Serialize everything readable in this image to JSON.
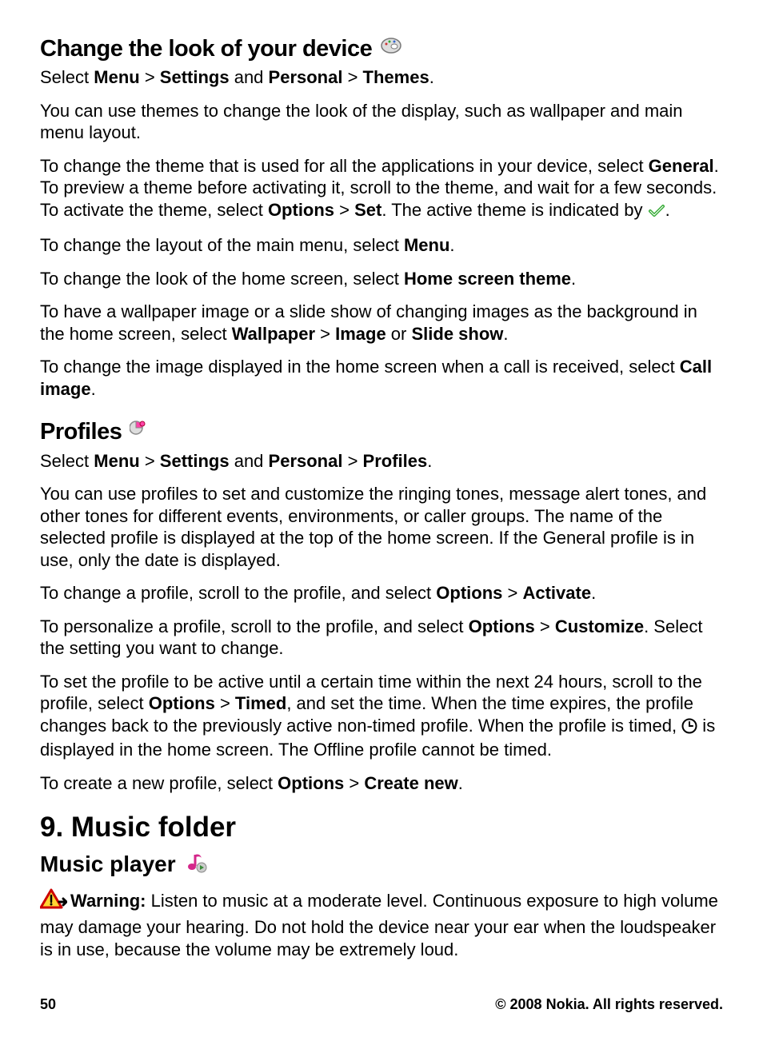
{
  "section1": {
    "title": "Change the look of your device",
    "nav_pre": "Select ",
    "nav_menu": "Menu",
    "nav_gt": " > ",
    "nav_settings": "Settings",
    "nav_and": " and ",
    "nav_personal": "Personal",
    "nav_themes": "Themes",
    "p1": "You can use themes to change the look of the display, such as wallpaper and main menu layout.",
    "p2a": "To change the theme that is used for all the applications in your device, select ",
    "p2b": "General",
    "p2c": ". To preview a theme before activating it, scroll to the theme, and wait for a few seconds. To activate the theme, select ",
    "p2d": "Options",
    "p2e": "Set",
    "p2f": ". The active theme is indicated by ",
    "p3a": "To change the layout of the main menu, select ",
    "p3b": "Menu",
    "p4a": "To change the look of the home screen, select ",
    "p4b": "Home screen theme",
    "p5a": "To have a wallpaper image or a slide show of changing images as the background in the home screen, select ",
    "p5b": "Wallpaper",
    "p5c": "Image",
    "p5d": " or ",
    "p5e": "Slide show",
    "p6a": "To change the image displayed in the home screen when a call is received, select ",
    "p6b": "Call image"
  },
  "section2": {
    "title": "Profiles",
    "nav_profiles": "Profiles",
    "p1": "You can use profiles to set and customize the ringing tones, message alert tones, and other tones for different events, environments, or caller groups. The name of the selected profile is displayed at the top of the home screen. If the General profile is in use, only the date is displayed.",
    "p2a": "To change a profile, scroll to the profile, and select ",
    "p2b": "Options",
    "p2c": "Activate",
    "p3a": "To personalize a profile, scroll to the profile, and select ",
    "p3b": "Options",
    "p3c": "Customize",
    "p3d": ". Select the setting you want to change.",
    "p4a": "To set the profile to be active until a certain time within the next 24 hours, scroll to the profile, select ",
    "p4b": "Options",
    "p4c": "Timed",
    "p4d": ", and set the time. When the time expires, the profile changes back to the previously active non-timed profile. When the profile is timed, ",
    "p4e": " is displayed in the home screen. The Offline profile cannot be timed.",
    "p5a": "To create a new profile, select ",
    "p5b": "Options",
    "p5c": "Create new"
  },
  "chapter": {
    "title": "9.   Music folder",
    "sub": "Music player",
    "warn_label": "Warning:",
    "warn_text": "  Listen to music at a moderate level. Continuous exposure to high volume may damage your hearing. Do not hold the device near your ear when the loudspeaker is in use, because the volume may be extremely loud."
  },
  "footer": {
    "page": "50",
    "copyright": "© 2008 Nokia. All rights reserved."
  }
}
